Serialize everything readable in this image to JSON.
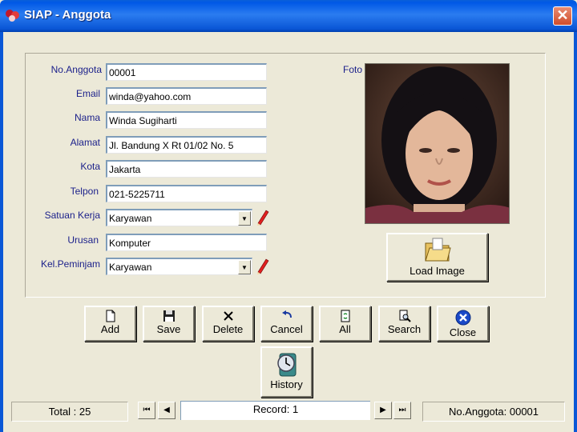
{
  "window": {
    "title": "SIAP - Anggota",
    "close_glyph": "✕"
  },
  "form": {
    "no_anggota": {
      "label": "No.Anggota",
      "value": "00001"
    },
    "email": {
      "label": "Email",
      "value": "winda@yahoo.com"
    },
    "nama": {
      "label": "Nama",
      "value": "Winda Sugiharti"
    },
    "alamat": {
      "label": "Alamat",
      "value": "Jl. Bandung X  Rt 01/02 No. 5"
    },
    "kota": {
      "label": "Kota",
      "value": "Jakarta"
    },
    "telpon": {
      "label": "Telpon",
      "value": "021-5225711"
    },
    "satuan_kerja": {
      "label": "Satuan Kerja",
      "value": "Karyawan"
    },
    "urusan": {
      "label": "Urusan",
      "value": "Komputer"
    },
    "kel_peminjam": {
      "label": "Kel.Peminjam",
      "value": "Karyawan"
    },
    "foto_label": "Foto"
  },
  "buttons": {
    "load_image": "Load Image",
    "add": "Add",
    "save": "Save",
    "delete": "Delete",
    "cancel": "Cancel",
    "all": "All",
    "search": "Search",
    "close": "Close",
    "history": "History"
  },
  "status": {
    "total": "Total : 25",
    "record": "Record: 1",
    "no_anggota": "No.Anggota: 00001"
  },
  "icons": {
    "combo_arrow": "▼",
    "first": "⏮",
    "prev": "◀",
    "next": "▶",
    "last": "⏭"
  }
}
